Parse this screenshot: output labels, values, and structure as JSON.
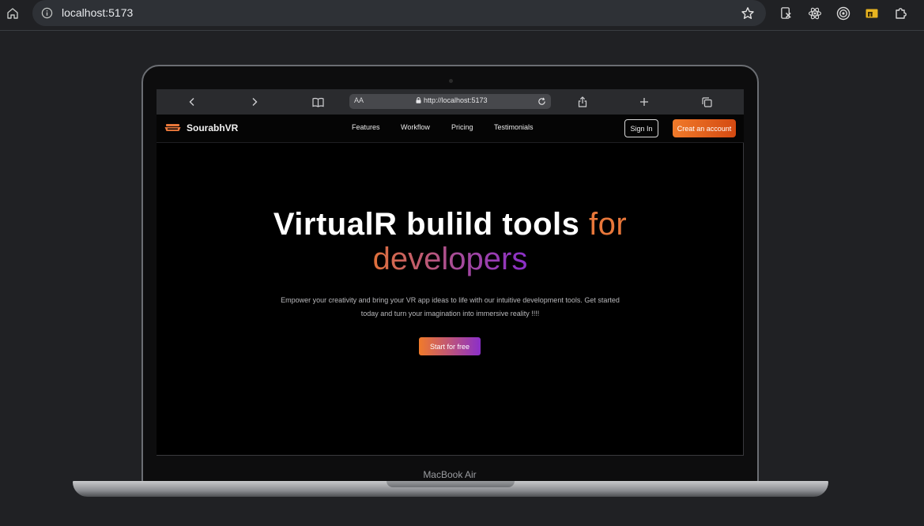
{
  "chrome": {
    "url": "localhost:5173",
    "icons": [
      "home-icon",
      "info-icon",
      "star-icon",
      "extension-x-icon",
      "react-icon",
      "record-icon",
      "folder-extension-icon",
      "puzzle-icon"
    ]
  },
  "safari": {
    "aa_label": "AA",
    "url": "http://localhost:5173",
    "icons": [
      "back-icon",
      "forward-icon",
      "book-icon",
      "lock-icon",
      "reload-icon",
      "share-icon",
      "plus-icon",
      "tabs-icon"
    ]
  },
  "site": {
    "brand": "SourabhVR",
    "nav": [
      "Features",
      "Workflow",
      "Pricing",
      "Testimonials"
    ],
    "signin_label": "Sign In",
    "create_label": "Creat an account",
    "hero": {
      "title_main": "VirtualR bulild tools ",
      "title_for": "for",
      "title_line2": "developers",
      "description_line1": "Empower your creativity and bring your VR app ideas to life with our intuitive development tools. Get started",
      "description_line2": "today and turn your imagination into immersive reality !!!!",
      "cta_label": "Start for free"
    }
  },
  "laptop": {
    "label": "MacBook Air"
  },
  "colors": {
    "accent_orange": "#e8773a",
    "accent_purple": "#8b2fc9",
    "page_bg": "#202124"
  }
}
